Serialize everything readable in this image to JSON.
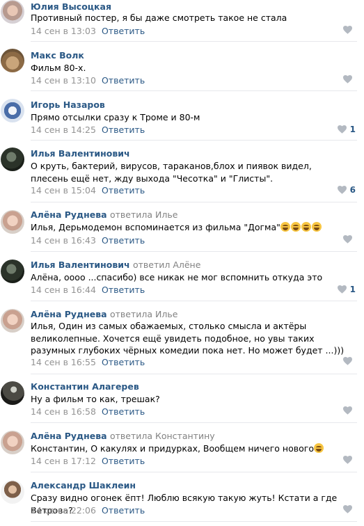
{
  "comments": [
    {
      "author": "Юлия Высоцкая",
      "reply_to": "",
      "text": "Противный постер, я бы даже смотреть такое не стала",
      "date": "14 сен в 13:03",
      "reply": "Ответить",
      "likes": ""
    },
    {
      "author": "Макс Волк",
      "reply_to": "",
      "text": "Фильм 80-х.",
      "date": "14 сен в 13:10",
      "reply": "Ответить",
      "likes": ""
    },
    {
      "author": "Игорь Назаров",
      "reply_to": "",
      "text": "Прямо отсылки сразу к Троме и 80-м",
      "date": "14 сен в 14:25",
      "reply": "Ответить",
      "likes": "1"
    },
    {
      "author": "Илья Валентинович",
      "reply_to": "",
      "text": "О круть, бактерий, вирусов, тараканов,блох и пиявок видел, плесень ещё нет, жду выхода \"Чесотка\" и \"Глисты\".",
      "date": "14 сен в 15:04",
      "reply": "Ответить",
      "likes": "6"
    },
    {
      "author": "Алёна Руднева",
      "reply_to": "ответила Илье",
      "text": "Илья, Дерьмодемон вспоминается из фильма \"Догма\"",
      "date": "14 сен в 16:43",
      "reply": "Ответить",
      "likes": ""
    },
    {
      "author": "Илья Валентинович",
      "reply_to": "ответил Алёне",
      "text": "Алёна, оооо ...спасибо) все никак не мог вспомнить откуда это",
      "date": "14 сен в 16:44",
      "reply": "Ответить",
      "likes": "1"
    },
    {
      "author": "Алёна Руднева",
      "reply_to": "ответила Илье",
      "text": "Илья, Один из самых обажаемых, столько смысла и актёры великолепные. Хочется ещё увидеть подобное, но увы таких разумных глубоких чёрных комедии пока нет. Но может будет ...)))",
      "date": "14 сен в 16:55",
      "reply": "Ответить",
      "likes": ""
    },
    {
      "author": "Константин Алагерев",
      "reply_to": "",
      "text": "Ну а фильм то как, трешак?",
      "date": "14 сен в 16:58",
      "reply": "Ответить",
      "likes": ""
    },
    {
      "author": "Алёна Руднева",
      "reply_to": "ответила Константину",
      "text": "Константин, О какулях и придурках, Вообщем ничего нового",
      "date": "14 сен в 17:12",
      "reply": "Ответить",
      "likes": ""
    },
    {
      "author": "Александр Шаклеин",
      "reply_to": "",
      "text": "Сразу видно огонек ёпт! Люблю всякую такую жуть! Кстати а где Ветрова?",
      "date": "14 сен в 22:06",
      "reply": "Ответить",
      "likes": ""
    }
  ],
  "colors": {
    "link": "#2a5885",
    "meta": "#939393",
    "reply_to": "#828282",
    "like_icon": "#b3b9c1",
    "separator": "#e7e8ec"
  },
  "icons": {
    "like": "heart-icon",
    "emoji": "laughing-emoji"
  }
}
